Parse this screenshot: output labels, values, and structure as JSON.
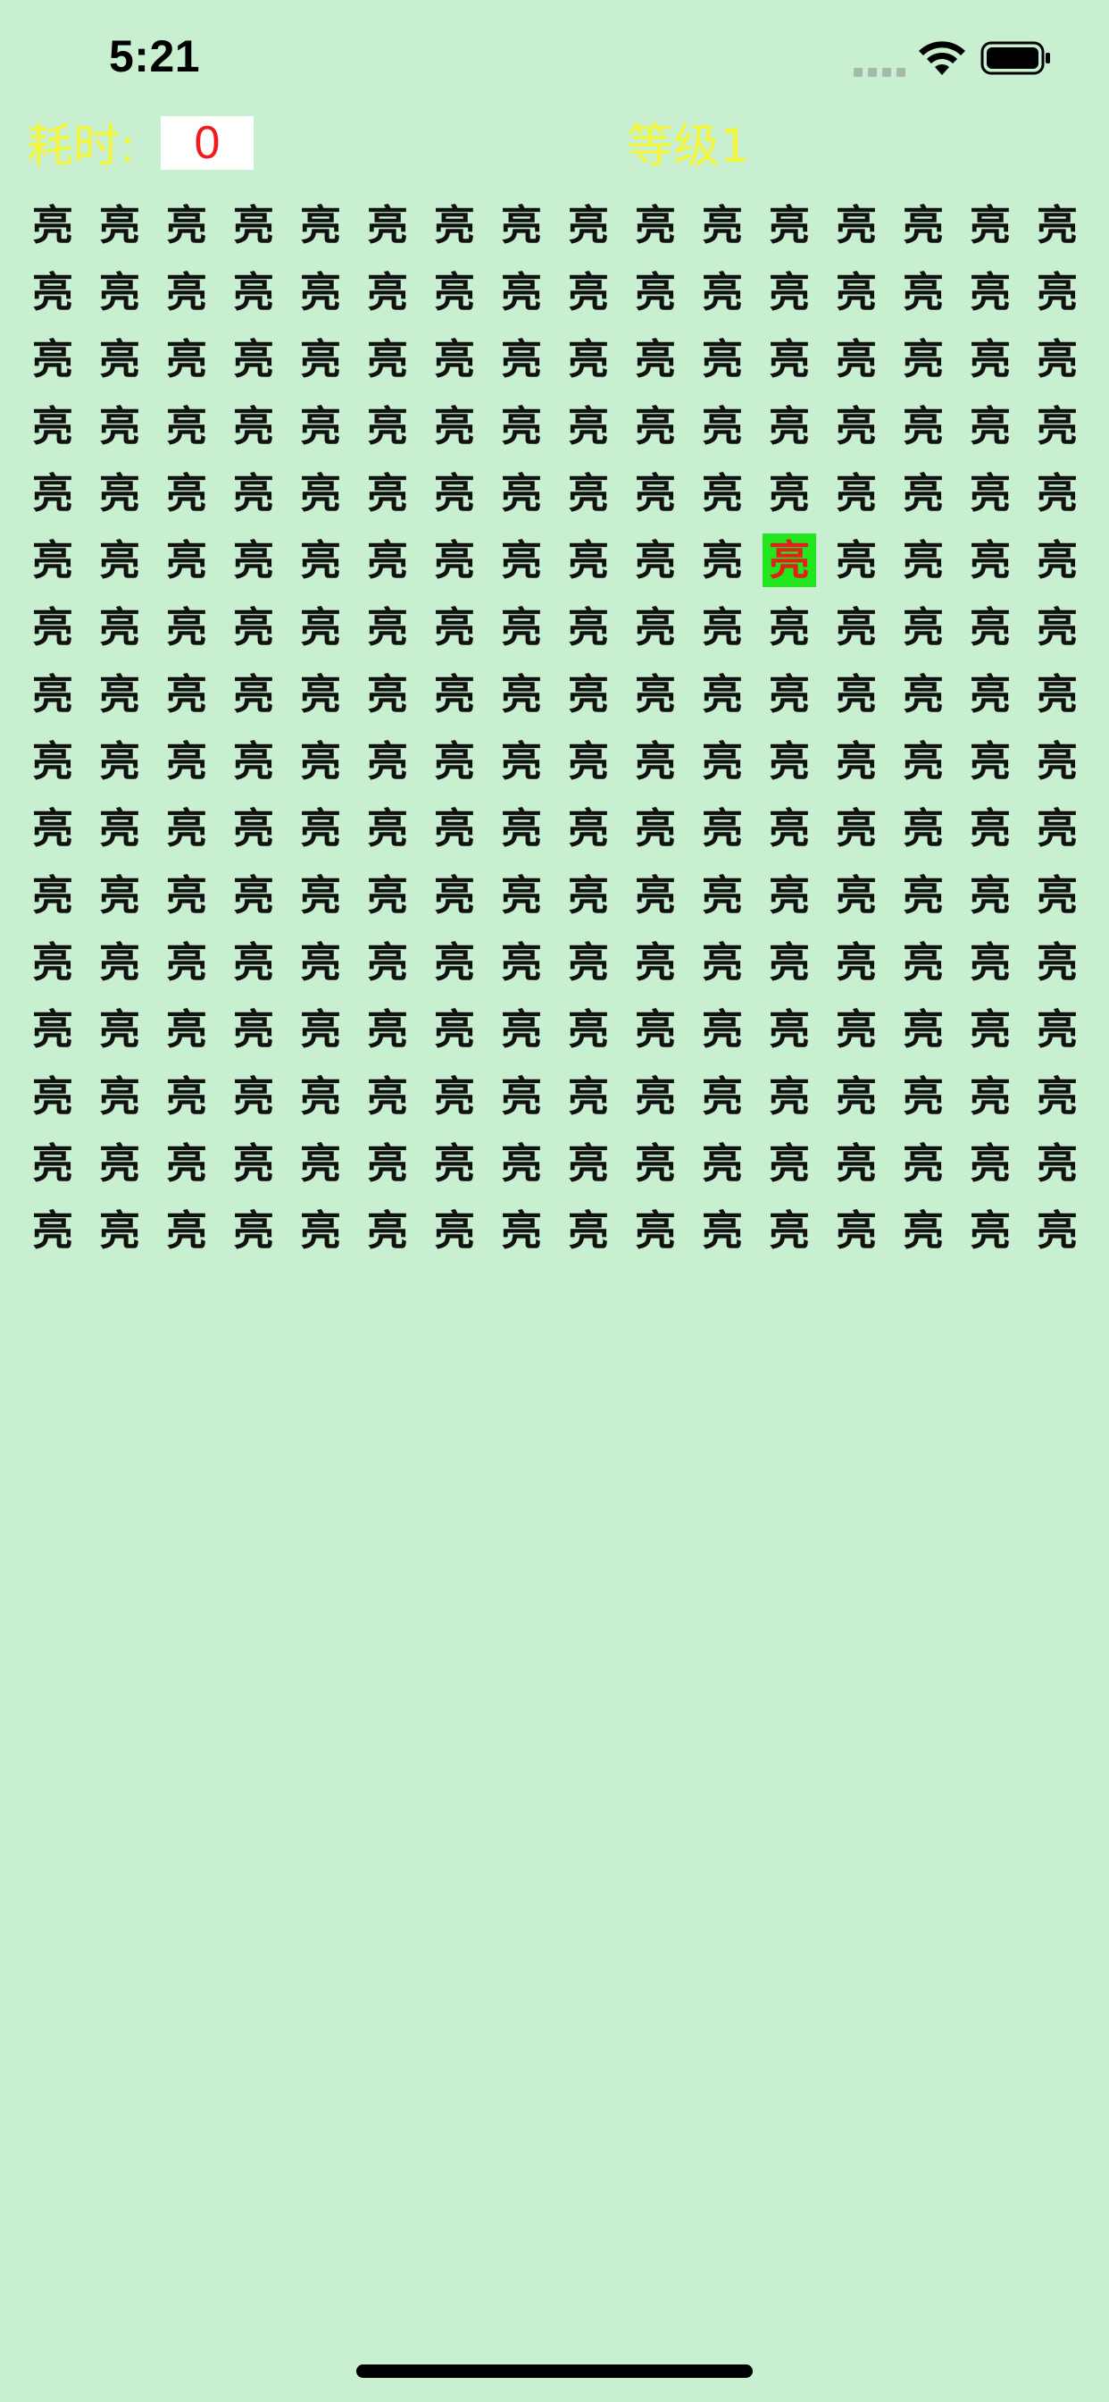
{
  "status_bar": {
    "time": "5:21",
    "icons": [
      "cellular-signal-icon",
      "wifi-icon",
      "battery-icon"
    ]
  },
  "hud": {
    "time_label": "耗时:",
    "elapsed": "0",
    "level_label": "等级1"
  },
  "board": {
    "rows": 16,
    "cols": 16,
    "character": "亮",
    "odd_character": "亮",
    "odd_position": {
      "row": 6,
      "col": 12
    },
    "colors": {
      "background": "#c8efcf",
      "cell_text": "#111111",
      "target_bg": "#22e61e",
      "target_text": "#e0201a",
      "hud_text": "#f2f53a",
      "elapsed_text": "#ee1c1c"
    }
  }
}
